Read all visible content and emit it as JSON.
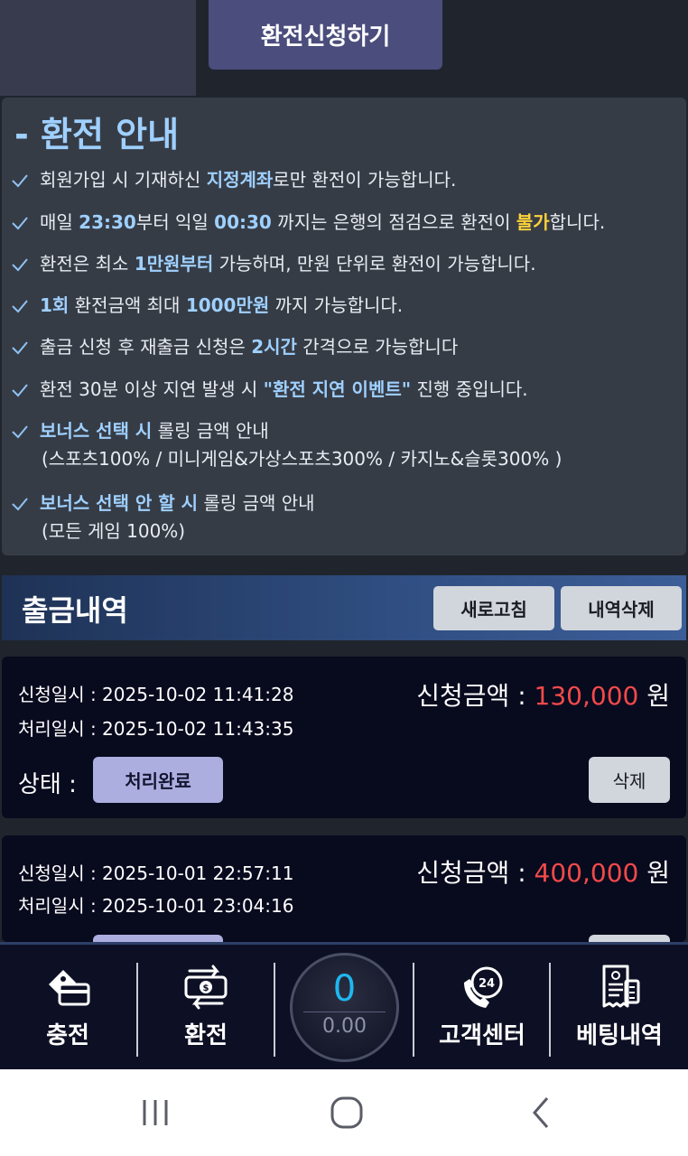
{
  "top": {
    "apply_label": "환전신청하기"
  },
  "guide": {
    "title": "- 환전 안내",
    "items": [
      {
        "segs": [
          {
            "t": "회원가입 시 기재하신 "
          },
          {
            "t": "지정계좌",
            "c": "hl"
          },
          {
            "t": "로만 환전이 가능합니다."
          }
        ]
      },
      {
        "segs": [
          {
            "t": "매일 "
          },
          {
            "t": "23:30",
            "c": "hl"
          },
          {
            "t": "부터 익일 "
          },
          {
            "t": "00:30",
            "c": "hl"
          },
          {
            "t": " 까지는 은행의 점검으로 환전이 "
          },
          {
            "t": "불가",
            "c": "hl-y"
          },
          {
            "t": "합니다."
          }
        ]
      },
      {
        "segs": [
          {
            "t": "환전은 최소 "
          },
          {
            "t": "1만원부터",
            "c": "hl"
          },
          {
            "t": " 가능하며, 만원 단위로 환전이 가능합니다."
          }
        ]
      },
      {
        "segs": [
          {
            "t": "1회",
            "c": "hl"
          },
          {
            "t": " 환전금액 최대 "
          },
          {
            "t": "1000만원",
            "c": "hl"
          },
          {
            "t": " 까지 가능합니다."
          }
        ]
      },
      {
        "segs": [
          {
            "t": "출금 신청 후 재출금 신청은 "
          },
          {
            "t": "2시간",
            "c": "hl"
          },
          {
            "t": " 간격으로 가능합니다"
          }
        ]
      },
      {
        "segs": [
          {
            "t": "환전 30분 이상 지연 발생 시 "
          },
          {
            "t": "\"환전 지연 이벤트\"",
            "c": "hl"
          },
          {
            "t": " 진행 중입니다."
          }
        ]
      },
      {
        "segs": [
          {
            "t": "보너스 선택 시",
            "c": "hl"
          },
          {
            "t": " 롤링 금액 안내"
          }
        ],
        "sub": "(스포츠100% / 미니게임&가상스포츠300% / 카지노&슬롯300% )"
      },
      {
        "segs": [
          {
            "t": "보너스 선택 안 할 시",
            "c": "hl"
          },
          {
            "t": " 롤링 금액 안내"
          }
        ],
        "sub": "(모든 게임 100%)"
      }
    ]
  },
  "history": {
    "title": "출금내역",
    "refresh_label": "새로고침",
    "delete_all_label": "내역삭제",
    "records": [
      {
        "request_time": "신청일시 : 2025-10-02 11:41:28",
        "process_time": "처리일시 : 2025-10-02 11:43:35",
        "amount_label": "신청금액 : ",
        "amount_value": "130,000",
        "amount_unit": " 원",
        "status_label": "상태 :",
        "status_value": "처리완료",
        "delete_label": "삭제"
      },
      {
        "request_time": "신청일시 : 2025-10-01 22:57:11",
        "process_time": "처리일시 : 2025-10-01 23:04:16",
        "amount_label": "신청금액 : ",
        "amount_value": "400,000",
        "amount_unit": " 원"
      }
    ]
  },
  "bottom_nav": {
    "charge": "충전",
    "exchange": "환전",
    "balance_main": "0",
    "balance_sub": "0.00",
    "support": "고객센터",
    "bet_history": "베팅내역"
  },
  "colors": {
    "accent_blue": "#9fd0ff",
    "accent_yellow": "#ffd23a",
    "amount_red": "#f24a4a"
  },
  "icons": [
    "check-icon",
    "charge-card-icon",
    "exchange-money-icon",
    "support-24-phone-icon",
    "bet-receipt-icon",
    "recent-apps-icon",
    "home-icon",
    "back-icon"
  ]
}
